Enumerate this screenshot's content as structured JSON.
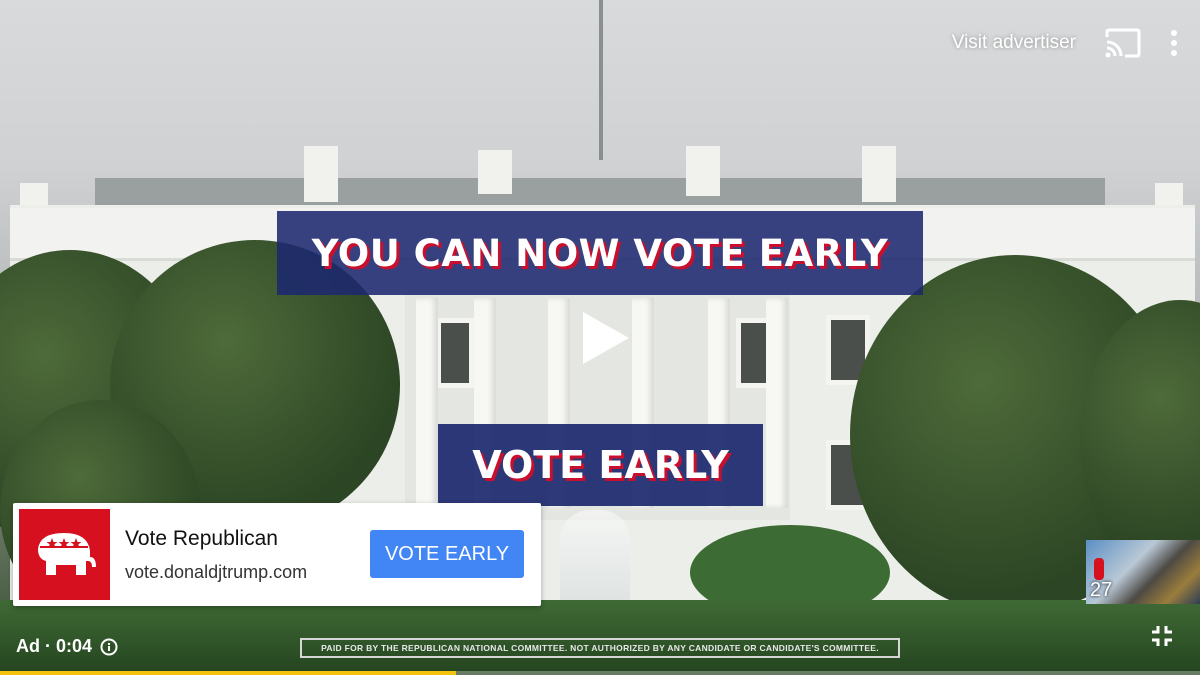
{
  "top_bar": {
    "visit_advertiser_label": "Visit advertiser"
  },
  "video": {
    "headline": "YOU CAN NOW VOTE EARLY",
    "subheadline": "VOTE EARLY",
    "disclaimer": "PAID FOR BY THE REPUBLICAN NATIONAL COMMITTEE. NOT AUTHORIZED BY ANY CANDIDATE OR CANDIDATE'S COMMITTEE.",
    "state": "paused"
  },
  "ad_card": {
    "title": "Vote Republican",
    "url": "vote.donaldjtrump.com",
    "cta_label": "VOTE EARLY",
    "logo": "republican-elephant-logo"
  },
  "ad_status": {
    "label": "Ad · 0:04",
    "progress_fraction": 0.38
  },
  "next_preview": {
    "count": "27"
  },
  "colors": {
    "banner_blue": "#1c286e",
    "accent_red": "#c8102e",
    "cta_blue": "#4285f4",
    "progress_yellow": "#f4c20d",
    "logo_red": "#d6101e"
  },
  "icons": [
    "cast-icon",
    "more-vert-icon",
    "play-icon",
    "info-icon",
    "fullscreen-exit-icon"
  ]
}
